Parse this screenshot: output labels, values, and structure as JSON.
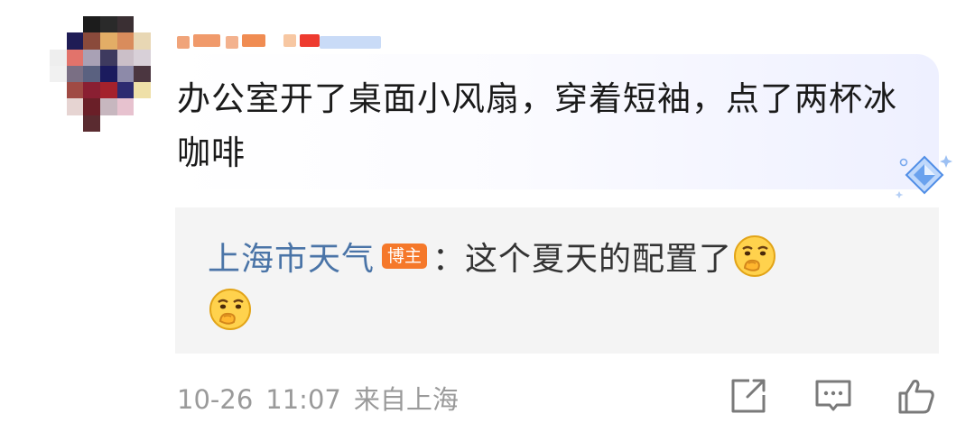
{
  "comment": {
    "text": "办公室开了桌面小风扇，穿着短袖，点了两杯冰咖啡"
  },
  "reply": {
    "user": "上海市天气",
    "badge": "博主",
    "separator": "：",
    "text": "这个夏天的配置了",
    "emoji": "thinking-hand-over-mouth-emoji"
  },
  "footer": {
    "date": "10-26",
    "time": "11:07",
    "location": "来自上海"
  },
  "actions": [
    "share-icon",
    "comment-icon",
    "like-icon"
  ],
  "colors": {
    "reply_user": "#4a74a7",
    "badge_bg": "#f5782a",
    "reply_bg": "#f4f4f4",
    "meta": "#9a9a9a"
  }
}
